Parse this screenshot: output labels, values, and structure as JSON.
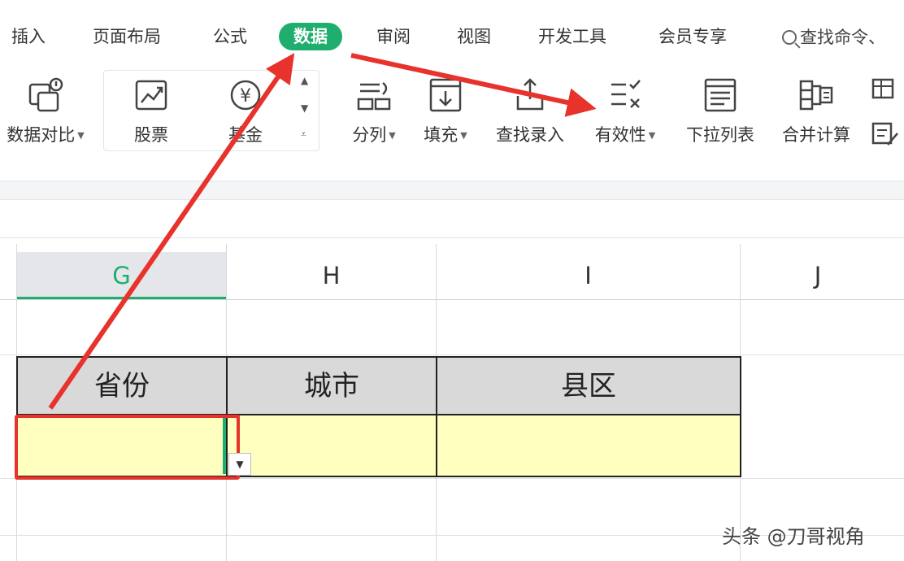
{
  "tabs": [
    "插入",
    "页面布局",
    "公式",
    "数据",
    "审阅",
    "视图",
    "开发工具",
    "会员专享"
  ],
  "active_tab": "数据",
  "search": {
    "label": "查找命令、"
  },
  "toolbar": {
    "compare": {
      "label": "数据对比",
      "icon": "compare-icon"
    },
    "stock": {
      "label": "股票",
      "icon": "stock-chart-icon"
    },
    "fund": {
      "label": "基金",
      "icon": "yen-coin-icon"
    },
    "split": {
      "label": "分列",
      "icon": "split-columns-icon"
    },
    "fill": {
      "label": "填充",
      "icon": "fill-down-icon"
    },
    "lookup": {
      "label": "查找录入",
      "icon": "lookup-entry-icon"
    },
    "validity": {
      "label": "有效性",
      "icon": "validation-icon"
    },
    "dropdown": {
      "label": "下拉列表",
      "icon": "dropdown-list-icon"
    },
    "consolidate": {
      "label": "合并计算",
      "icon": "consolidate-icon"
    }
  },
  "columns": [
    "G",
    "H",
    "I",
    "J"
  ],
  "selected_column": "G",
  "table": {
    "headers": [
      "省份",
      "城市",
      "县区"
    ],
    "row": [
      "",
      "",
      ""
    ]
  },
  "watermark": "头条 @刀哥视角",
  "colors": {
    "accent_green": "#1fae6e",
    "arrow_red": "#e8322c",
    "header_fill": "#d9d9d9",
    "data_fill": "#ffffbf"
  }
}
